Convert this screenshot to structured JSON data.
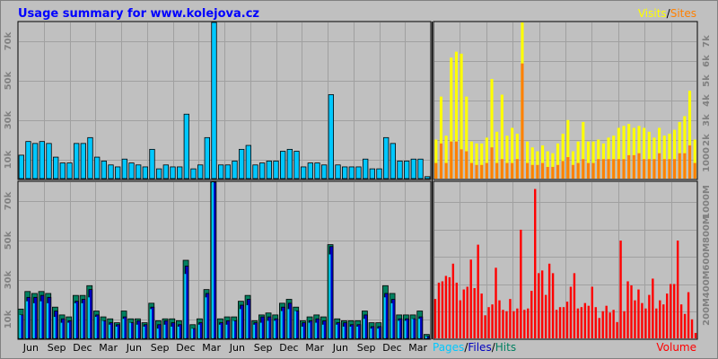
{
  "title": "Usage summary for www.kolejova.cz",
  "colors": {
    "background": "#c0c0c0",
    "title": "#0000ff",
    "pages": "#00c8ff",
    "files": "#0000c0",
    "hits": "#008060",
    "visits": "#ffff00",
    "sites": "#ff8000",
    "volume": "#ff0000"
  },
  "chart_data": [
    {
      "type": "bar",
      "name": "pages",
      "ytick_labels": [
        "10k",
        "30k",
        "50k",
        "70k"
      ],
      "yticks": [
        10000,
        30000,
        50000,
        70000
      ],
      "ylim": [
        0,
        80000
      ],
      "series": [
        {
          "values": [
            12000,
            19000,
            18000,
            19000,
            18000,
            11000,
            8000,
            8000,
            18000,
            18000,
            21000,
            11000,
            9000,
            7000,
            6000,
            10000,
            8000,
            7000,
            6000,
            15000,
            5000,
            7000,
            6000,
            6000,
            33000,
            5000,
            7000,
            21000,
            83000,
            7000,
            7000,
            9000,
            15000,
            17000,
            7000,
            8000,
            9000,
            9000,
            14000,
            15000,
            14000,
            6000,
            8000,
            8000,
            7000,
            43000,
            7000,
            6000,
            6000,
            6000,
            10000,
            5000,
            5000,
            21000,
            18000,
            9000,
            9000,
            10000,
            10000,
            1000
          ]
        }
      ]
    },
    {
      "type": "bar",
      "name": "hits-files-pages",
      "legend": [
        "Pages",
        "Files",
        "Hits"
      ],
      "ytick_labels": [
        "10k",
        "30k",
        "50k",
        "70k"
      ],
      "yticks": [
        10000,
        30000,
        50000,
        70000
      ],
      "xtick_labels": [
        "Jun",
        "Sep",
        "Dec",
        "Mar",
        "Jun",
        "Sep",
        "Dec",
        "Mar",
        "Jun",
        "Sep",
        "Dec",
        "Mar",
        "Jun",
        "Sep",
        "Dec",
        "Mar"
      ],
      "ylim": [
        0,
        80000
      ],
      "series": [
        {
          "name": "Hits",
          "values": [
            15000,
            24000,
            23000,
            24000,
            23000,
            16000,
            12000,
            11000,
            22000,
            22000,
            27000,
            14000,
            11000,
            10000,
            8000,
            14000,
            10000,
            10000,
            8000,
            18000,
            9000,
            10000,
            10000,
            9000,
            40000,
            7000,
            10000,
            25000,
            92000,
            10000,
            11000,
            11000,
            19000,
            22000,
            9000,
            12000,
            13000,
            12000,
            18000,
            20000,
            16000,
            9000,
            11000,
            12000,
            11000,
            48000,
            10000,
            9000,
            9000,
            9000,
            14000,
            8000,
            8000,
            27000,
            23000,
            12000,
            12000,
            12000,
            14000,
            2000
          ]
        },
        {
          "name": "Files",
          "values": [
            12000,
            21000,
            21000,
            22000,
            21000,
            14000,
            10000,
            9000,
            19000,
            20000,
            25000,
            12000,
            9000,
            8000,
            7000,
            11000,
            8000,
            9000,
            7000,
            16000,
            7000,
            9000,
            8000,
            7000,
            37000,
            5000,
            8000,
            23000,
            90000,
            8000,
            9000,
            9000,
            17000,
            20000,
            8000,
            11000,
            11000,
            10000,
            16000,
            18000,
            14000,
            8000,
            9000,
            10000,
            9000,
            47000,
            8000,
            8000,
            7000,
            7000,
            12000,
            6000,
            6000,
            23000,
            20000,
            10000,
            10000,
            10000,
            11000,
            1000
          ]
        },
        {
          "name": "Pages",
          "values": [
            12000,
            19000,
            18000,
            19000,
            18000,
            11000,
            8000,
            8000,
            18000,
            18000,
            21000,
            11000,
            9000,
            7000,
            6000,
            10000,
            8000,
            7000,
            6000,
            15000,
            5000,
            7000,
            6000,
            6000,
            33000,
            5000,
            7000,
            21000,
            83000,
            7000,
            7000,
            9000,
            15000,
            17000,
            7000,
            8000,
            9000,
            9000,
            14000,
            15000,
            14000,
            6000,
            8000,
            8000,
            7000,
            43000,
            7000,
            6000,
            6000,
            6000,
            10000,
            5000,
            5000,
            21000,
            18000,
            9000,
            9000,
            10000,
            10000,
            1000
          ]
        }
      ]
    },
    {
      "type": "bar",
      "name": "visits-sites",
      "legend": [
        "Visits",
        "Sites"
      ],
      "ytick_labels": [
        "1000",
        "2k",
        "3k",
        "4k",
        "5k",
        "6k",
        "7k"
      ],
      "yticks": [
        1000,
        2000,
        3000,
        4000,
        5000,
        6000,
        7000
      ],
      "ylim": [
        0,
        8000
      ],
      "series": [
        {
          "name": "Visits",
          "values": [
            2000,
            4200,
            2200,
            6200,
            6500,
            6400,
            4200,
            1900,
            1800,
            1800,
            2100,
            5100,
            2400,
            4300,
            2200,
            2600,
            2300,
            8200,
            1900,
            1600,
            1400,
            1700,
            1400,
            1300,
            1800,
            2300,
            3000,
            1400,
            1900,
            2900,
            1900,
            1900,
            2000,
            1800,
            2100,
            2200,
            2600,
            2700,
            2800,
            2600,
            2700,
            2600,
            2400,
            2100,
            2600,
            2200,
            2300,
            2500,
            2900,
            3200,
            4500,
            2000
          ]
        },
        {
          "name": "Sites",
          "values": [
            800,
            1800,
            800,
            1900,
            1900,
            1500,
            1400,
            800,
            700,
            700,
            800,
            1600,
            800,
            1000,
            800,
            800,
            1000,
            5900,
            800,
            700,
            700,
            800,
            600,
            600,
            700,
            900,
            1100,
            700,
            800,
            1000,
            800,
            800,
            1000,
            1000,
            1000,
            1000,
            1000,
            1000,
            1200,
            1200,
            1300,
            1000,
            1000,
            1000,
            1300,
            1000,
            1000,
            1000,
            1300,
            1300,
            1700,
            800
          ]
        }
      ]
    },
    {
      "type": "bar",
      "name": "volume",
      "legend": [
        "Volume"
      ],
      "ytick_labels": [
        "200M",
        "400M",
        "600M",
        "800M",
        "1000M"
      ],
      "yticks": [
        200,
        400,
        600,
        800,
        1000
      ],
      "ylim": [
        0,
        1150
      ],
      "series": [
        {
          "name": "Volume",
          "values": [
            290,
            410,
            420,
            460,
            450,
            550,
            410,
            280,
            360,
            380,
            580,
            370,
            690,
            330,
            170,
            230,
            250,
            520,
            280,
            210,
            200,
            290,
            200,
            220,
            800,
            210,
            220,
            350,
            1100,
            480,
            500,
            320,
            550,
            480,
            210,
            230,
            230,
            270,
            380,
            480,
            220,
            230,
            260,
            240,
            380,
            230,
            150,
            200,
            240,
            190,
            210,
            120,
            720,
            200,
            420,
            390,
            280,
            360,
            260,
            220,
            320,
            440,
            220,
            280,
            250,
            330,
            400,
            400,
            720,
            250,
            180,
            340,
            140,
            40
          ]
        }
      ]
    }
  ]
}
